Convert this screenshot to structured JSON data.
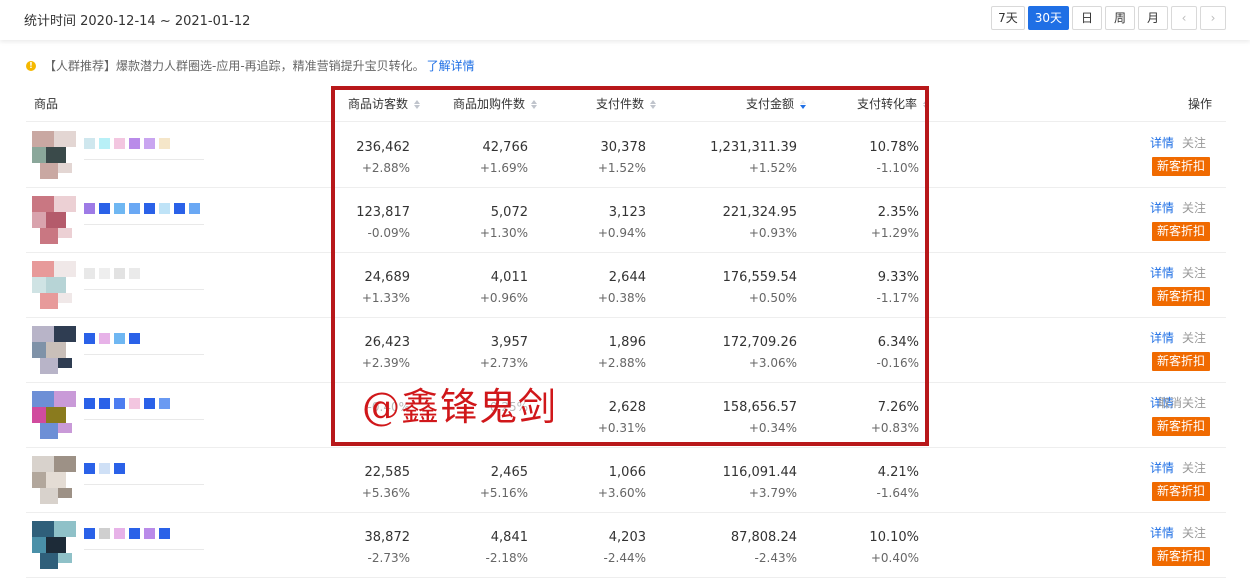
{
  "header": {
    "range_label": "统计时间 2020-12-14 ~ 2021-01-12",
    "periods": [
      "7天",
      "30天",
      "日",
      "周",
      "月"
    ],
    "active_period": "30天",
    "prev_icon": "chevron-left-icon",
    "next_icon": "chevron-right-icon"
  },
  "notice": {
    "icon": "alert-icon",
    "text": "【人群推荐】爆款潜力人群圈选-应用-再追踪，精准营销提升宝贝转化。",
    "link": "了解详情"
  },
  "columns": {
    "product": "商品",
    "visitors": "商品访客数",
    "cart": "商品加购件数",
    "paid_items": "支付件数",
    "paid_amount": "支付金额",
    "conversion": "支付转化率",
    "ops": "操作"
  },
  "sorted_column": "支付金额",
  "rows": [
    {
      "visitors": "236,462",
      "visitors_chg": "+2.88%",
      "cart": "42,766",
      "cart_chg": "+1.69%",
      "items": "30,378",
      "items_chg": "+1.52%",
      "amount": "1,231,311.39",
      "amount_chg": "+1.52%",
      "conv": "10.78%",
      "conv_chg": "-1.10%",
      "detail": "详情",
      "follow": "关注",
      "badge": "新客折扣"
    },
    {
      "visitors": "123,817",
      "visitors_chg": "-0.09%",
      "cart": "5,072",
      "cart_chg": "+1.30%",
      "items": "3,123",
      "items_chg": "+0.94%",
      "amount": "221,324.95",
      "amount_chg": "+0.93%",
      "conv": "2.35%",
      "conv_chg": "+1.29%",
      "detail": "详情",
      "follow": "关注",
      "badge": "新客折扣"
    },
    {
      "visitors": "24,689",
      "visitors_chg": "+1.33%",
      "cart": "4,011",
      "cart_chg": "+0.96%",
      "items": "2,644",
      "items_chg": "+0.38%",
      "amount": "176,559.54",
      "amount_chg": "+0.50%",
      "conv": "9.33%",
      "conv_chg": "-1.17%",
      "detail": "详情",
      "follow": "关注",
      "badge": "新客折扣"
    },
    {
      "visitors": "26,423",
      "visitors_chg": "+2.39%",
      "cart": "3,957",
      "cart_chg": "+2.73%",
      "items": "1,896",
      "items_chg": "+2.88%",
      "amount": "172,709.26",
      "amount_chg": "+3.06%",
      "conv": "6.34%",
      "conv_chg": "-0.16%",
      "detail": "详情",
      "follow": "关注",
      "badge": "新客折扣"
    },
    {
      "visitors": "",
      "visitors_chg": "-0.40%",
      "cart": "",
      "cart_chg": "-0.25%",
      "items": "2,628",
      "items_chg": "+0.31%",
      "amount": "158,656.57",
      "amount_chg": "+0.34%",
      "conv": "7.26%",
      "conv_chg": "+0.83%",
      "detail": "详情",
      "follow": "取消关注",
      "badge": "新客折扣"
    },
    {
      "visitors": "22,585",
      "visitors_chg": "+5.36%",
      "cart": "2,465",
      "cart_chg": "+5.16%",
      "items": "1,066",
      "items_chg": "+3.60%",
      "amount": "116,091.44",
      "amount_chg": "+3.79%",
      "conv": "4.21%",
      "conv_chg": "-1.64%",
      "detail": "详情",
      "follow": "关注",
      "badge": "新客折扣"
    },
    {
      "visitors": "38,872",
      "visitors_chg": "-2.73%",
      "cart": "4,841",
      "cart_chg": "-2.18%",
      "items": "4,203",
      "items_chg": "-2.44%",
      "amount": "87,808.24",
      "amount_chg": "-2.43%",
      "conv": "10.10%",
      "conv_chg": "+0.40%",
      "detail": "详情",
      "follow": "关注",
      "badge": "新客折扣"
    }
  ],
  "watermark": "@鑫锋鬼剑",
  "colors": {
    "accent": "#1f6fe5",
    "badge": "#f06a00",
    "highlight": "#b8181a"
  }
}
